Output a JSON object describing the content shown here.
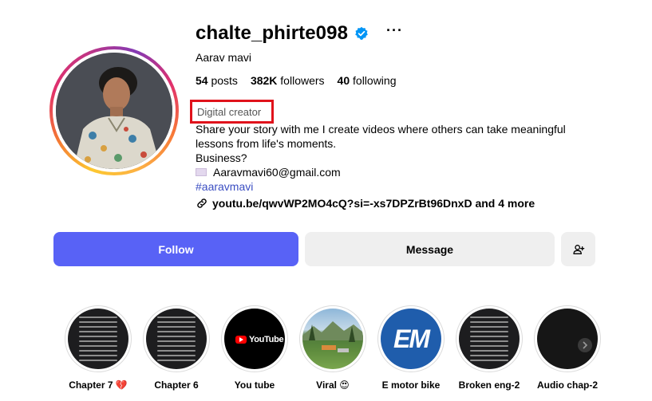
{
  "profile": {
    "username": "chalte_phirte098",
    "more": "···",
    "full_name": "Aarav mavi",
    "posts_count": "54",
    "posts_label": "posts",
    "followers_count": "382K",
    "followers_label": "followers",
    "following_count": "40",
    "following_label": "following",
    "category": "Digital creator",
    "bio_line1": "Share your story with me I create videos where others can take meaningful",
    "bio_line2": "lessons from life's moments.",
    "bio_line3": "Business?",
    "email": "Aaravmavi60@gmail.com",
    "hashtag": "#aaravmavi",
    "link": "youtu.be/qwvWP2MO4cQ?si=-xs7DPZrBt96DnxD and 4 more"
  },
  "actions": {
    "follow_label": "Follow",
    "message_label": "Message"
  },
  "highlights": [
    {
      "label": "Chapter 7 💔"
    },
    {
      "label": "Chapter 6"
    },
    {
      "label": "You tube",
      "inner_text": "YouTube"
    },
    {
      "label": "Viral 😍"
    },
    {
      "label": "E motor bike",
      "inner_text": "EM"
    },
    {
      "label": "Broken eng-2"
    },
    {
      "label": "Audio chap-2"
    }
  ],
  "colors": {
    "follow_button": "#5862f6",
    "verified_badge": "#0095f6",
    "hashtag": "#3b4ec2",
    "category_outline": "#e0121b"
  }
}
